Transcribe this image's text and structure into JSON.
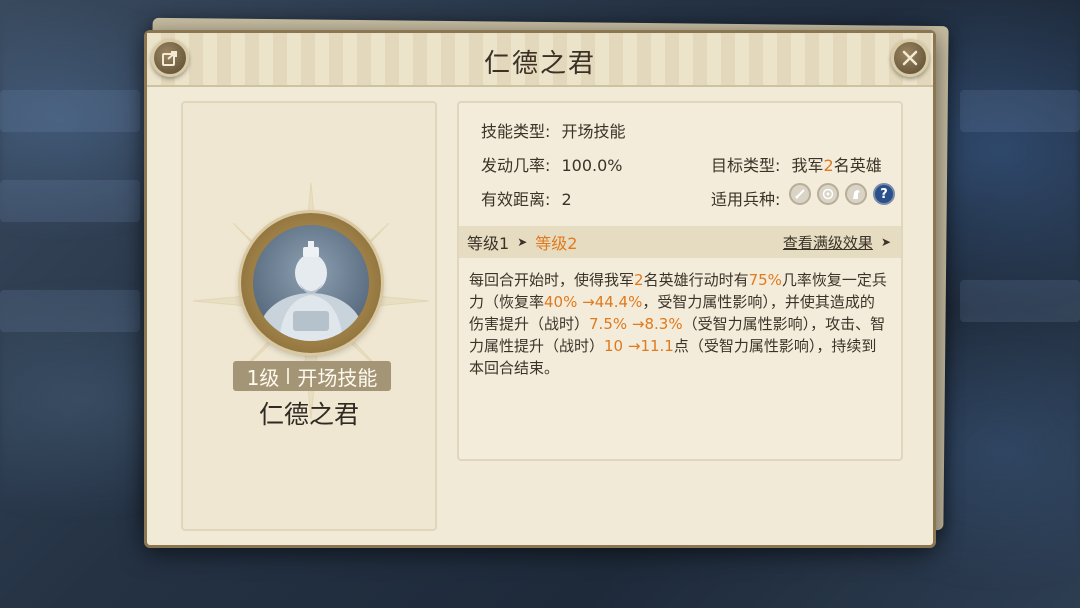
{
  "dialog": {
    "title": "仁德之君",
    "share_icon": "share-icon",
    "close_icon": "close-icon"
  },
  "skill_card": {
    "level": "1级",
    "category": "开场技能",
    "name": "仁德之君"
  },
  "details": {
    "skill_type_label": "技能类型:",
    "skill_type_value": "开场技能",
    "trigger_rate_label": "发动几率:",
    "trigger_rate_value": "100.0%",
    "range_label": "有效距离:",
    "range_value": "2",
    "target_type_label": "目标类型:",
    "target_prefix": "我军",
    "target_count": "2",
    "target_suffix": "名英雄",
    "troop_type_label": "适用兵种:",
    "troop_icons": [
      "sword-icon",
      "bow-icon",
      "horse-icon",
      "question-icon"
    ]
  },
  "level_bar": {
    "level1": "等级1",
    "arrow": "➤",
    "level2": "等级2",
    "max_effect_link": "查看满级效果",
    "link_arrow": "➤"
  },
  "description": {
    "p1": "每回合开始时，使得我军",
    "n1": "2",
    "p2": "名英雄行动时有",
    "n2": "75%",
    "p3": "几率恢复一定兵力（恢复率",
    "n3": "40% →44.4%",
    "p4": "，受智力属性影响），并使其造成的伤害提升（战时）",
    "n4": "7.5% →8.3%",
    "p5": "（受智力属性影响），攻击、智力属性提升（战时）",
    "n5": "10 →11.1",
    "p6": "点（受智力属性影响），持续到本回合结束。"
  },
  "colors": {
    "highlight": "#e07a1f",
    "text": "#3b3328",
    "panel": "#f1ead6"
  }
}
